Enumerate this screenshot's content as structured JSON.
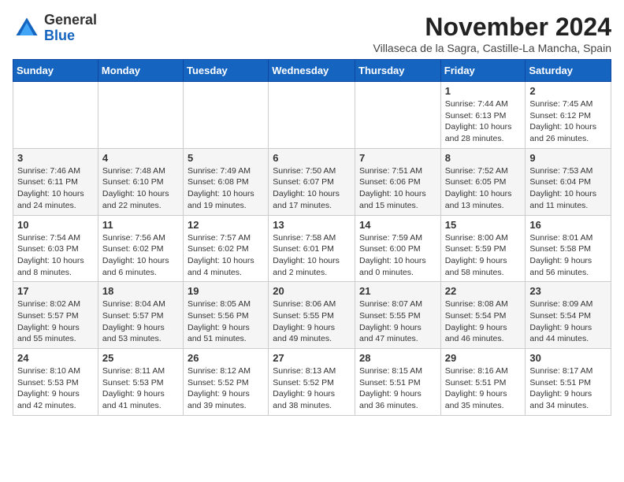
{
  "logo": {
    "general": "General",
    "blue": "Blue"
  },
  "title": {
    "month_year": "November 2024",
    "location": "Villaseca de la Sagra, Castille-La Mancha, Spain"
  },
  "days_of_week": [
    "Sunday",
    "Monday",
    "Tuesday",
    "Wednesday",
    "Thursday",
    "Friday",
    "Saturday"
  ],
  "weeks": [
    [
      {
        "day": "",
        "info": ""
      },
      {
        "day": "",
        "info": ""
      },
      {
        "day": "",
        "info": ""
      },
      {
        "day": "",
        "info": ""
      },
      {
        "day": "",
        "info": ""
      },
      {
        "day": "1",
        "info": "Sunrise: 7:44 AM\nSunset: 6:13 PM\nDaylight: 10 hours and 28 minutes."
      },
      {
        "day": "2",
        "info": "Sunrise: 7:45 AM\nSunset: 6:12 PM\nDaylight: 10 hours and 26 minutes."
      }
    ],
    [
      {
        "day": "3",
        "info": "Sunrise: 7:46 AM\nSunset: 6:11 PM\nDaylight: 10 hours and 24 minutes."
      },
      {
        "day": "4",
        "info": "Sunrise: 7:48 AM\nSunset: 6:10 PM\nDaylight: 10 hours and 22 minutes."
      },
      {
        "day": "5",
        "info": "Sunrise: 7:49 AM\nSunset: 6:08 PM\nDaylight: 10 hours and 19 minutes."
      },
      {
        "day": "6",
        "info": "Sunrise: 7:50 AM\nSunset: 6:07 PM\nDaylight: 10 hours and 17 minutes."
      },
      {
        "day": "7",
        "info": "Sunrise: 7:51 AM\nSunset: 6:06 PM\nDaylight: 10 hours and 15 minutes."
      },
      {
        "day": "8",
        "info": "Sunrise: 7:52 AM\nSunset: 6:05 PM\nDaylight: 10 hours and 13 minutes."
      },
      {
        "day": "9",
        "info": "Sunrise: 7:53 AM\nSunset: 6:04 PM\nDaylight: 10 hours and 11 minutes."
      }
    ],
    [
      {
        "day": "10",
        "info": "Sunrise: 7:54 AM\nSunset: 6:03 PM\nDaylight: 10 hours and 8 minutes."
      },
      {
        "day": "11",
        "info": "Sunrise: 7:56 AM\nSunset: 6:02 PM\nDaylight: 10 hours and 6 minutes."
      },
      {
        "day": "12",
        "info": "Sunrise: 7:57 AM\nSunset: 6:02 PM\nDaylight: 10 hours and 4 minutes."
      },
      {
        "day": "13",
        "info": "Sunrise: 7:58 AM\nSunset: 6:01 PM\nDaylight: 10 hours and 2 minutes."
      },
      {
        "day": "14",
        "info": "Sunrise: 7:59 AM\nSunset: 6:00 PM\nDaylight: 10 hours and 0 minutes."
      },
      {
        "day": "15",
        "info": "Sunrise: 8:00 AM\nSunset: 5:59 PM\nDaylight: 9 hours and 58 minutes."
      },
      {
        "day": "16",
        "info": "Sunrise: 8:01 AM\nSunset: 5:58 PM\nDaylight: 9 hours and 56 minutes."
      }
    ],
    [
      {
        "day": "17",
        "info": "Sunrise: 8:02 AM\nSunset: 5:57 PM\nDaylight: 9 hours and 55 minutes."
      },
      {
        "day": "18",
        "info": "Sunrise: 8:04 AM\nSunset: 5:57 PM\nDaylight: 9 hours and 53 minutes."
      },
      {
        "day": "19",
        "info": "Sunrise: 8:05 AM\nSunset: 5:56 PM\nDaylight: 9 hours and 51 minutes."
      },
      {
        "day": "20",
        "info": "Sunrise: 8:06 AM\nSunset: 5:55 PM\nDaylight: 9 hours and 49 minutes."
      },
      {
        "day": "21",
        "info": "Sunrise: 8:07 AM\nSunset: 5:55 PM\nDaylight: 9 hours and 47 minutes."
      },
      {
        "day": "22",
        "info": "Sunrise: 8:08 AM\nSunset: 5:54 PM\nDaylight: 9 hours and 46 minutes."
      },
      {
        "day": "23",
        "info": "Sunrise: 8:09 AM\nSunset: 5:54 PM\nDaylight: 9 hours and 44 minutes."
      }
    ],
    [
      {
        "day": "24",
        "info": "Sunrise: 8:10 AM\nSunset: 5:53 PM\nDaylight: 9 hours and 42 minutes."
      },
      {
        "day": "25",
        "info": "Sunrise: 8:11 AM\nSunset: 5:53 PM\nDaylight: 9 hours and 41 minutes."
      },
      {
        "day": "26",
        "info": "Sunrise: 8:12 AM\nSunset: 5:52 PM\nDaylight: 9 hours and 39 minutes."
      },
      {
        "day": "27",
        "info": "Sunrise: 8:13 AM\nSunset: 5:52 PM\nDaylight: 9 hours and 38 minutes."
      },
      {
        "day": "28",
        "info": "Sunrise: 8:15 AM\nSunset: 5:51 PM\nDaylight: 9 hours and 36 minutes."
      },
      {
        "day": "29",
        "info": "Sunrise: 8:16 AM\nSunset: 5:51 PM\nDaylight: 9 hours and 35 minutes."
      },
      {
        "day": "30",
        "info": "Sunrise: 8:17 AM\nSunset: 5:51 PM\nDaylight: 9 hours and 34 minutes."
      }
    ]
  ]
}
